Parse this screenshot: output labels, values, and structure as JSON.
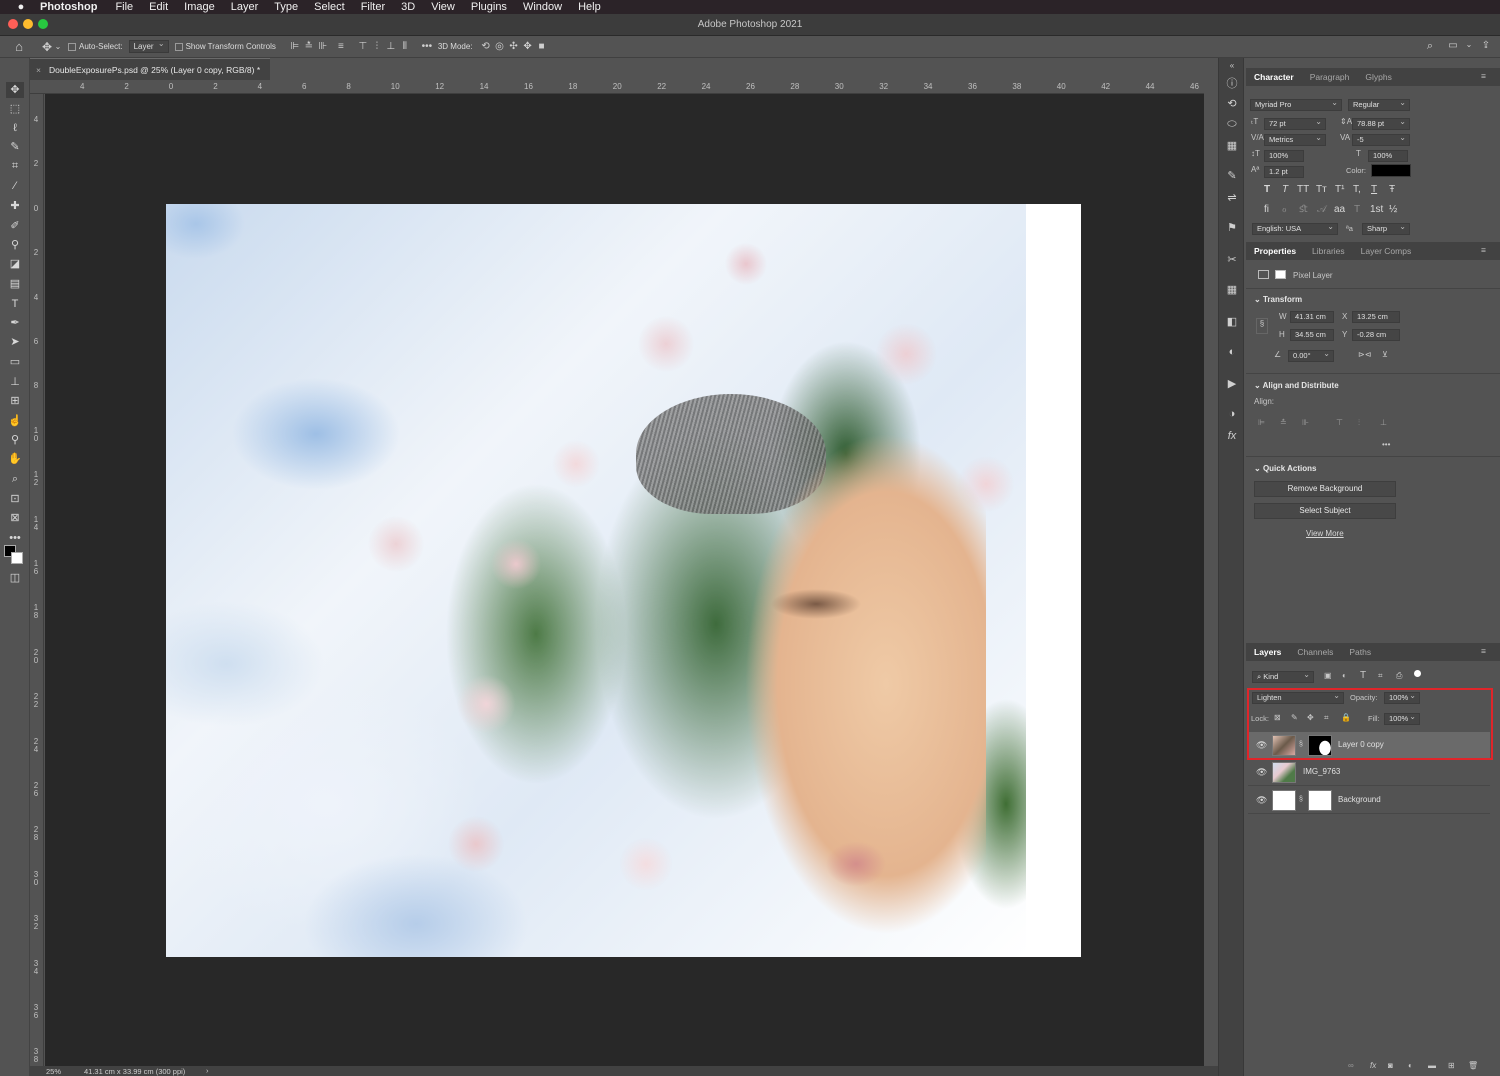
{
  "menubar": {
    "app": "Photoshop",
    "items": [
      "File",
      "Edit",
      "Image",
      "Layer",
      "Type",
      "Select",
      "Filter",
      "3D",
      "View",
      "Plugins",
      "Window",
      "Help"
    ]
  },
  "titlebar": {
    "title": "Adobe Photoshop 2021"
  },
  "options": {
    "auto_select_label": "Auto-Select:",
    "auto_select_value": "Layer",
    "show_transform": "Show Transform Controls",
    "three_d_mode": "3D Mode:",
    "more": "•••"
  },
  "document": {
    "tab_title": "DoubleExposurePs.psd @ 25% (Layer 0 copy, RGB/8) *",
    "close": "×"
  },
  "rulers": {
    "h": [
      "4",
      "2",
      "0",
      "2",
      "4",
      "6",
      "8",
      "10",
      "12",
      "14",
      "16",
      "18",
      "20",
      "22",
      "24",
      "26",
      "28",
      "30",
      "32",
      "34",
      "36",
      "38",
      "40",
      "42",
      "44",
      "46"
    ],
    "v": [
      "4",
      "2",
      "0",
      "2",
      "4",
      "6",
      "8",
      "10",
      "12",
      "14",
      "16",
      "18",
      "20",
      "22",
      "24",
      "26",
      "28",
      "30",
      "32",
      "34",
      "36",
      "38"
    ]
  },
  "status": {
    "zoom": "25%",
    "doc_size": "41.31 cm x 33.99 cm (300 ppi)",
    "arrow": "›"
  },
  "character": {
    "tabs": [
      "Character",
      "Paragraph",
      "Glyphs"
    ],
    "font_family": "Myriad Pro",
    "font_style": "Regular",
    "size": "72 pt",
    "leading": "78.88 pt",
    "kerning": "Metrics",
    "tracking": "-5",
    "vscale": "100%",
    "hscale": "100%",
    "baseline": "1.2 pt",
    "color_label": "Color:",
    "color": "#000000",
    "language": "English: USA",
    "aa_label": "ªa",
    "antialias": "Sharp",
    "style_buttons": [
      "T",
      "T",
      "TT",
      "Tт",
      "T¹",
      "T,",
      "T",
      "Ŧ"
    ],
    "opentype_buttons": [
      "fi",
      "ℴ",
      "ﬆ",
      "𝒜",
      "aa",
      "T",
      "1st",
      "½"
    ]
  },
  "properties": {
    "tabs": [
      "Properties",
      "Libraries",
      "Layer Comps"
    ],
    "kind": "Pixel Layer",
    "transform_title": "Transform",
    "w_label": "W",
    "w": "41.31 cm",
    "x_label": "X",
    "x": "13.25 cm",
    "h_label": "H",
    "h": "34.55 cm",
    "y_label": "Y",
    "y": "-0.28 cm",
    "angle": "0.00°",
    "align_title": "Align and Distribute",
    "align_label": "Align:",
    "align_more": "•••",
    "quick_title": "Quick Actions",
    "remove_bg": "Remove Background",
    "select_subject": "Select Subject",
    "view_more": "View More"
  },
  "layers_panel": {
    "tabs": [
      "Layers",
      "Channels",
      "Paths"
    ],
    "filter": "Kind",
    "blend_mode": "Lighten",
    "opacity_label": "Opacity:",
    "opacity": "100%",
    "lock_label": "Lock:",
    "fill_label": "Fill:",
    "fill": "100%",
    "layers": [
      {
        "name": "Layer 0 copy",
        "selected": true
      },
      {
        "name": "IMG_9763",
        "selected": false
      },
      {
        "name": "Background",
        "selected": false
      }
    ],
    "footer_icons": [
      "link-icon",
      "fx-icon",
      "mask-icon",
      "adjustment-icon",
      "folder-icon",
      "new-layer-icon",
      "trash-icon"
    ]
  },
  "colors": {
    "highlight": "#e0252a",
    "selected_layer": "#6a6a6a"
  }
}
